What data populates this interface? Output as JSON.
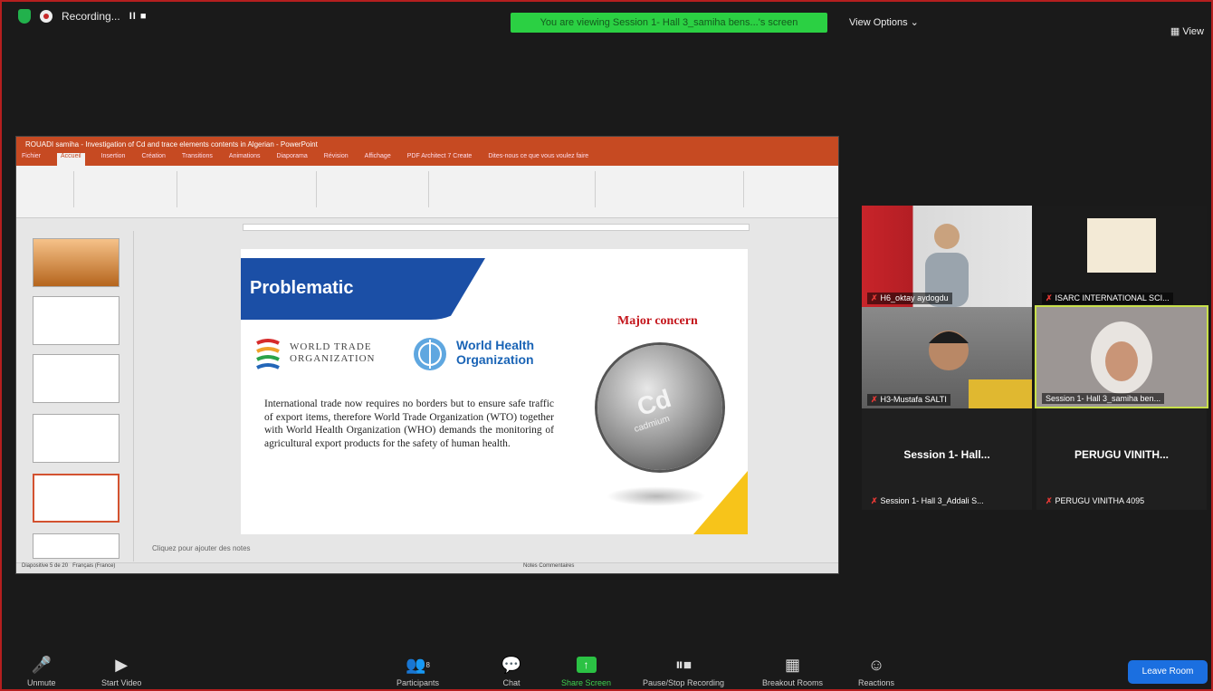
{
  "topbar": {
    "recording_label": "Recording...",
    "pause_stop": "II ■",
    "viewing_banner": "You are viewing Session 1- Hall 3_samiha bens...'s screen",
    "view_options": "View Options ⌄",
    "view_label": "View"
  },
  "ppt": {
    "window_title": "ROUADI samiha - Investigation of Cd and trace elements contents in Algerian - PowerPoint",
    "tabs": [
      "Fichier",
      "Accueil",
      "Insertion",
      "Création",
      "Transitions",
      "Animations",
      "Diaporama",
      "Révision",
      "Affichage",
      "PDF Architect 7 Create",
      "Dites-nous ce que vous voulez faire"
    ],
    "slide_thumbs": [
      "1",
      "2",
      "3",
      "4",
      "5",
      "6"
    ],
    "notes_placeholder": "Cliquez pour ajouter des notes",
    "status_left": "Diapositive 5 de 20",
    "status_lang": "Français (France)",
    "status_right": "Notes   Commentaires"
  },
  "slide": {
    "title": "Problematic",
    "major": "Major concern",
    "wto_line1": "WORLD TRADE",
    "wto_line2": "ORGANIZATION",
    "who_line1": "World Health",
    "who_line2": "Organization",
    "body": "International trade now requires no borders but to ensure safe traffic of export items, therefore World Trade Organization (WTO) together with World Health Organization (WHO) demands the monitoring of agricultural export products for the safety of human health.",
    "coin_symbol": "Cd",
    "coin_name": "cadmium"
  },
  "participants": [
    {
      "name": "H6_oktay aydogdu",
      "muted": true
    },
    {
      "name": "ISARC INTERNATIONAL SCI...",
      "muted": true
    },
    {
      "name": "H3-Mustafa SALTI",
      "muted": true
    },
    {
      "name": "Session 1- Hall 3_samiha ben...",
      "muted": false
    },
    {
      "display": "Session 1- Hall...",
      "name": "Session 1- Hall 3_Addali S...",
      "muted": true
    },
    {
      "display": "PERUGU VINITH...",
      "name": "PERUGU VINITHA 4095",
      "muted": true
    }
  ],
  "toolbar": {
    "unmute": "Unmute",
    "start_video": "Start Video",
    "participants": "Participants",
    "participants_count": "8",
    "chat": "Chat",
    "share_screen": "Share Screen",
    "pause_stop_recording": "Pause/Stop Recording",
    "breakout_rooms": "Breakout Rooms",
    "reactions": "Reactions",
    "leave_room": "Leave Room"
  }
}
